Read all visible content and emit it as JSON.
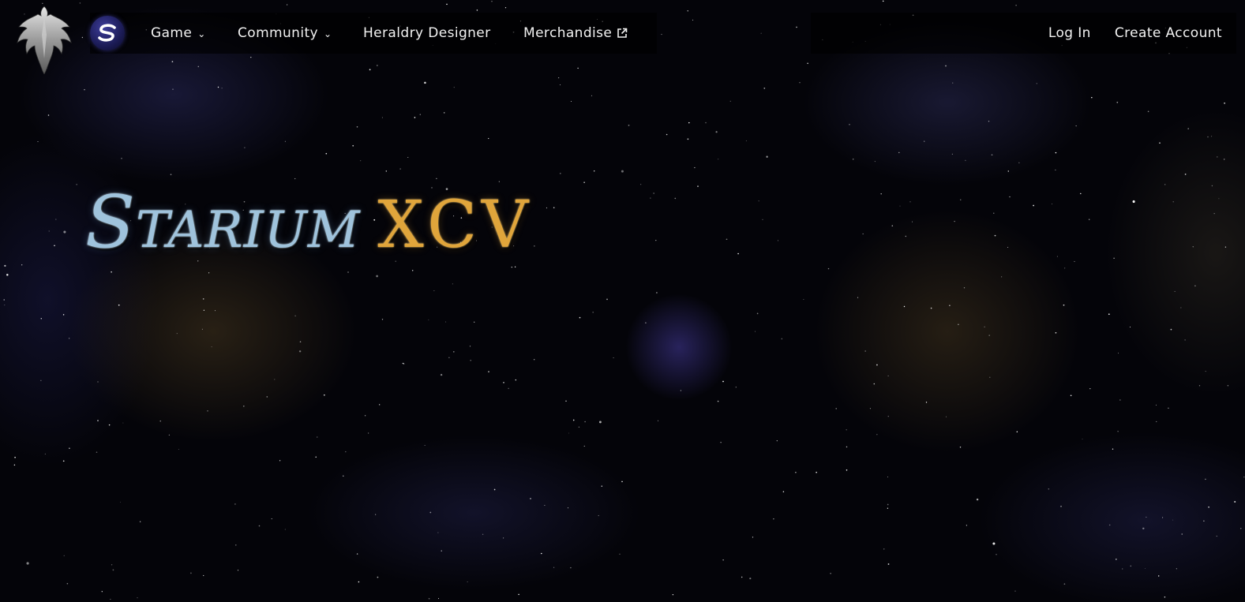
{
  "nav": {
    "emblem_icon": "winged-phoenix-icon",
    "logo_icon": "s-logo-icon",
    "game_label": "Game",
    "community_label": "Community",
    "heraldry_label": "Heraldry Designer",
    "merch_label": "Merchandise",
    "login_label": "Log In",
    "create_account_label": "Create Account"
  },
  "hero": {
    "title_main": "Starium",
    "title_numeral": "XCV"
  },
  "colors": {
    "title_main": "#9fc3dc",
    "title_numeral": "#e0a53b",
    "nav_text": "#f2f2f2",
    "background": "#040409"
  }
}
